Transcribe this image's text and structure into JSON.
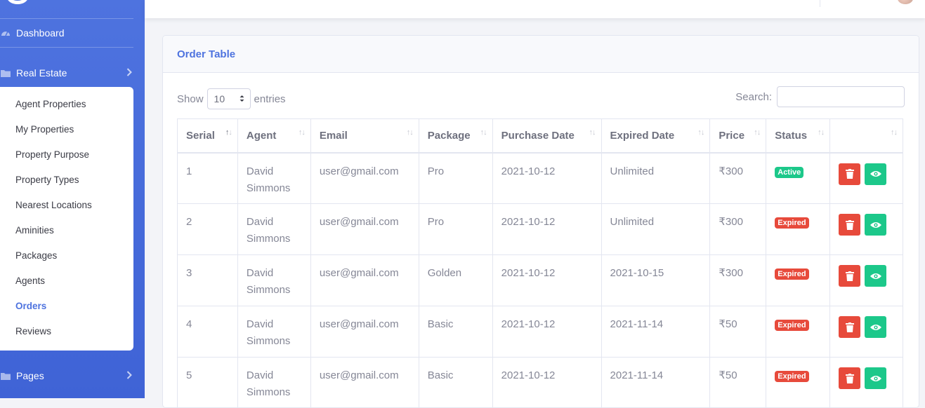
{
  "sidebar": {
    "items": [
      {
        "label": "Dashboard",
        "icon": "dashboard-icon"
      },
      {
        "label": "Real Estate",
        "icon": "folder-icon"
      },
      {
        "label": "Pages",
        "icon": "folder-icon"
      }
    ],
    "submenu": [
      {
        "label": "Agent Properties"
      },
      {
        "label": "My Properties"
      },
      {
        "label": "Property Purpose"
      },
      {
        "label": "Property Types"
      },
      {
        "label": "Nearest Locations"
      },
      {
        "label": "Aminities"
      },
      {
        "label": "Packages"
      },
      {
        "label": "Agents"
      },
      {
        "label": "Orders",
        "active": true
      },
      {
        "label": "Reviews"
      }
    ]
  },
  "card": {
    "title": "Order Table",
    "show_label": "Show",
    "entries_value": "10",
    "entries_label": "entries",
    "search_label": "Search:",
    "search_value": ""
  },
  "table": {
    "headers": [
      "Serial",
      "Agent",
      "Email",
      "Package",
      "Purchase Date",
      "Expired Date",
      "Price",
      "Status",
      ""
    ],
    "rows": [
      {
        "serial": "1",
        "agent_first": "David",
        "agent_last": "Simmons",
        "email": "user@gmail.com",
        "package": "Pro",
        "purchase": "2021-10-12",
        "expired": "Unlimited",
        "price": "₹300",
        "status": "Active"
      },
      {
        "serial": "2",
        "agent_first": "David",
        "agent_last": "Simmons",
        "email": "user@gmail.com",
        "package": "Pro",
        "purchase": "2021-10-12",
        "expired": "Unlimited",
        "price": "₹300",
        "status": "Expired"
      },
      {
        "serial": "3",
        "agent_first": "David",
        "agent_last": "Simmons",
        "email": "user@gmail.com",
        "package": "Golden",
        "purchase": "2021-10-12",
        "expired": "2021-10-15",
        "price": "₹300",
        "status": "Expired"
      },
      {
        "serial": "4",
        "agent_first": "David",
        "agent_last": "Simmons",
        "email": "user@gmail.com",
        "package": "Basic",
        "purchase": "2021-10-12",
        "expired": "2021-11-14",
        "price": "₹50",
        "status": "Expired"
      },
      {
        "serial": "5",
        "agent_first": "David",
        "agent_last": "Simmons",
        "email": "user@gmail.com",
        "package": "Basic",
        "purchase": "2021-10-12",
        "expired": "2021-11-14",
        "price": "₹50",
        "status": "Expired"
      }
    ]
  },
  "colors": {
    "primary": "#4e73df",
    "active_badge": "#1cc88a",
    "expired_badge": "#e74a3b",
    "delete_button": "#e74a3b",
    "view_button": "#1cc88a"
  },
  "icons": {
    "delete": "trash-icon",
    "view": "eye-icon"
  }
}
